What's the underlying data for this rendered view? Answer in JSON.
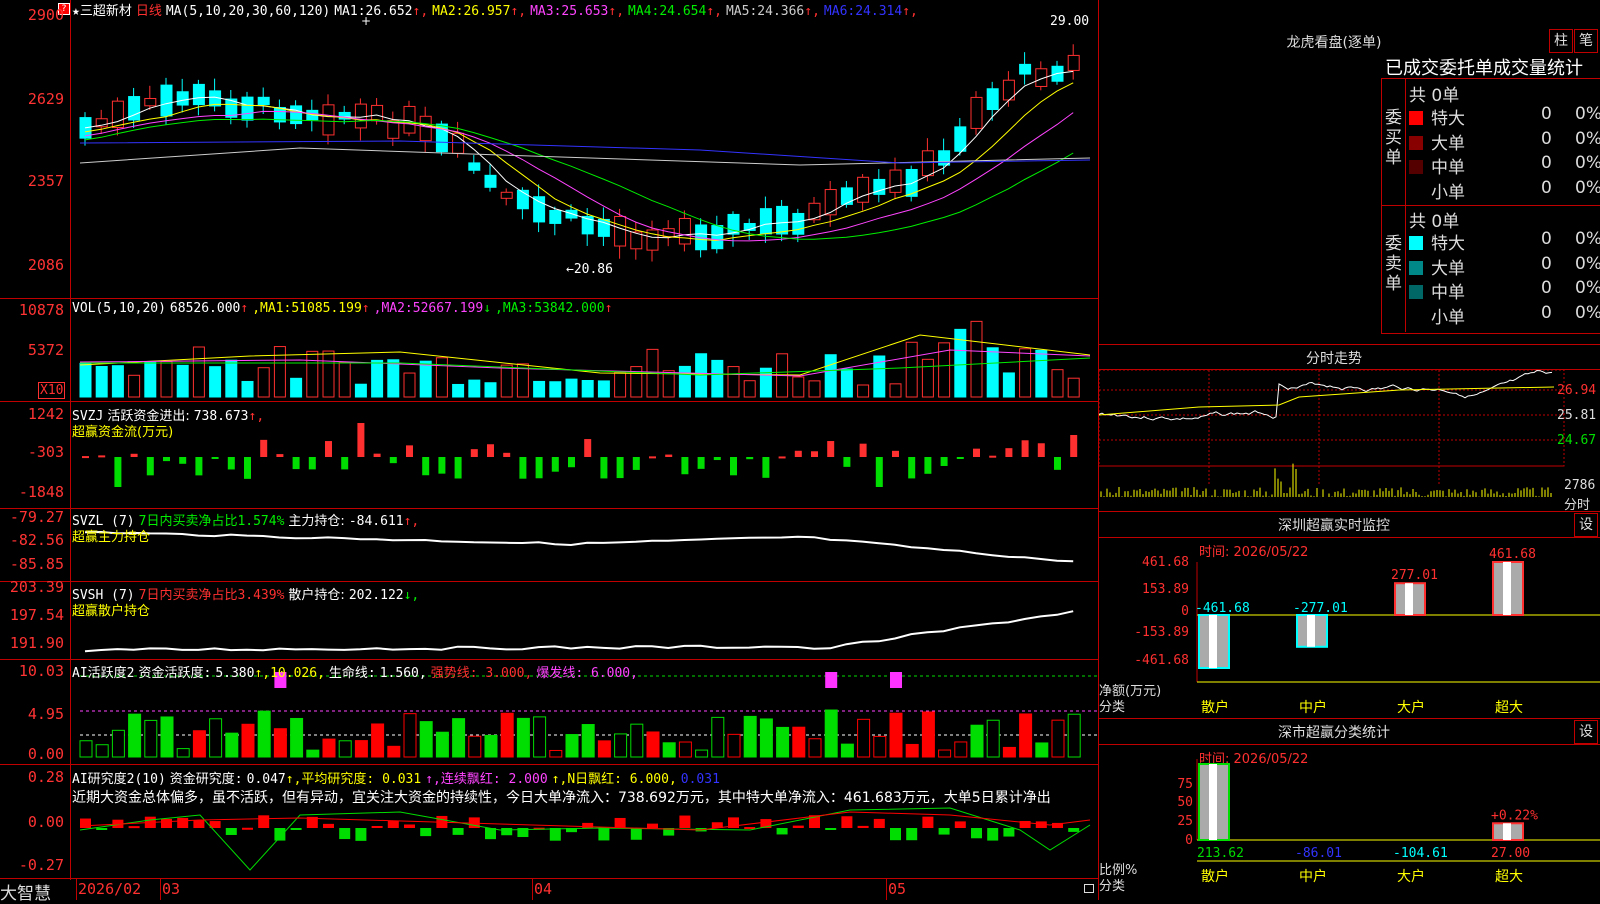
{
  "main": {
    "star": "★",
    "stock_name": "三超新材",
    "period": "日线",
    "ma_label": "MA(5,10,20,30,60,120)",
    "ma": [
      {
        "label": "MA1:",
        "value": "26.652",
        "arrow": "↑",
        "color": "#ffffff"
      },
      {
        "label": "MA2:",
        "value": "26.957",
        "arrow": "↑",
        "color": "#ffff00"
      },
      {
        "label": "MA3:",
        "value": "25.653",
        "arrow": "↑",
        "color": "#ff44ff"
      },
      {
        "label": "MA4:",
        "value": "24.654",
        "arrow": "↑",
        "color": "#00ee00"
      },
      {
        "label": "MA5:",
        "value": "24.366",
        "arrow": "↑",
        "color": "#cccccc"
      },
      {
        "label": "MA6:",
        "value": "24.314",
        "arrow": "↑",
        "color": "#3333ff"
      }
    ],
    "y_labels": [
      "2900",
      "2629",
      "2357",
      "2086"
    ],
    "high_label": "29.00",
    "low_label": "←20.86"
  },
  "vol": {
    "label": "VOL(5,10,20)",
    "value": "68526.000",
    "arrow": "↑",
    "ma": [
      {
        "label": "MA1:",
        "value": "51085.199",
        "arrow": "↑",
        "color": "#ffff00"
      },
      {
        "label": "MA2:",
        "value": "52667.199",
        "arrow": "↓",
        "color": "#ff44ff"
      },
      {
        "label": "MA3:",
        "value": "53842.000",
        "arrow": "↑",
        "color": "#00ee00"
      }
    ],
    "y_labels": [
      "10878",
      "5372"
    ],
    "unit": "X10"
  },
  "svzj": {
    "title": "SVZJ",
    "desc": "活跃资金进出:",
    "value": "738.673",
    "arrow": "↑,",
    "sub": "超赢资金流(万元)",
    "y_labels": [
      "1242",
      "-303",
      "-1848"
    ]
  },
  "svzl": {
    "title": "SVZL (7)",
    "ratio": "7日内买卖净占比1.574%",
    "label": "主力持仓:",
    "value": "-84.611",
    "arrow": "↑,",
    "sub": "超赢主力持仓",
    "y_labels": [
      "-79.27",
      "-82.56",
      "-85.85"
    ]
  },
  "svsh": {
    "title": "SVSH (7)",
    "ratio": "7日内买卖净占比3.439%",
    "label": "散户持仓:",
    "value": "202.122",
    "arrow": "↓,",
    "sub": "超赢散户持仓",
    "y_labels": [
      "203.39",
      "197.54",
      "191.90"
    ]
  },
  "ai1": {
    "title": "AI活跃度2",
    "label": "资金活跃度:",
    "value": "5.380",
    "v2": "↑,10.026,",
    "life_label": "生命线:",
    "life": "1.560,",
    "strong": "强势线: 3.000,",
    "burst": "爆发线: 6.000,",
    "y_labels": [
      "10.03",
      "4.95",
      "0.00"
    ]
  },
  "ai2": {
    "title": "AI研究度2(10)",
    "label": "资金研究度:",
    "value": "0.047",
    "avg": "↑,平均研究度: 0.031",
    "red": "↑,连续飘红: 2.000",
    "nred": "↑,N日飘红: 6.000,",
    "last": "0.031",
    "comment": "近期大资金总体偏多，虽不活跃，但有异动，宜关注大资金的持续性，今日大单净流入：738.692万元，其中特大单净流入：461.683万元，大单5日累计净出",
    "y_labels": [
      "0.28",
      "0.00",
      "-0.27"
    ]
  },
  "footer": {
    "brand": "大智慧",
    "dates": [
      "2026/02",
      "03",
      "04",
      "05"
    ]
  },
  "dragon": {
    "title": "龙虎看盘(逐单)",
    "btn1": "柱",
    "btn2": "笔",
    "tabs": "已成交委托单成交量统计",
    "buy_label": "委买单",
    "sell_label": "委卖单",
    "buy_total": "共 0单",
    "sell_total": "共 0单",
    "buy_rows": [
      {
        "name": "特大",
        "count": "0",
        "pct": "0%",
        "color": "#ff0000"
      },
      {
        "name": "大单",
        "count": "0",
        "pct": "0%",
        "color": "#880000"
      },
      {
        "name": "中单",
        "count": "0",
        "pct": "0%",
        "color": "#550000"
      },
      {
        "name": "小单",
        "count": "0",
        "pct": "0%",
        "color": ""
      }
    ],
    "sell_rows": [
      {
        "name": "特大",
        "count": "0",
        "pct": "0%",
        "color": "#00ffff"
      },
      {
        "name": "大单",
        "count": "0",
        "pct": "0%",
        "color": "#008888"
      },
      {
        "name": "中单",
        "count": "0",
        "pct": "0%",
        "color": "#006666"
      },
      {
        "name": "小单",
        "count": "0",
        "pct": "0%",
        "color": ""
      }
    ]
  },
  "intraday": {
    "title": "分时走势",
    "y_labels": [
      "26.94",
      "25.81",
      "24.67"
    ],
    "vol_label": "2786",
    "vol_unit": "分时"
  },
  "sz_monitor": {
    "title": "深圳超赢实时监控",
    "btn": "设",
    "date": "时间: 2026/05/22",
    "y_labels": [
      "461.68",
      "153.89",
      "0",
      "-153.89",
      "-461.68"
    ],
    "unit": "净额(万元)",
    "cat_label": "分类",
    "bars": [
      {
        "cat": "散户",
        "value": -461.68,
        "label": "-461.68"
      },
      {
        "cat": "中户",
        "value": -277.01,
        "label": "-277.01"
      },
      {
        "cat": "大户",
        "value": 277.01,
        "label": "277.01"
      },
      {
        "cat": "超大",
        "value": 461.68,
        "label": "461.68"
      }
    ]
  },
  "sz_stat": {
    "title": "深市超赢分类统计",
    "btn": "设",
    "date": "时间: 2026/05/22",
    "y_labels": [
      "75",
      "50",
      "25",
      "0"
    ],
    "unit": "比例%",
    "cat_label": "分类",
    "bars": [
      {
        "cat": "散户",
        "value": 100,
        "label": "213.62"
      },
      {
        "cat": "中户",
        "value": 0,
        "label": "-86.01"
      },
      {
        "cat": "大户",
        "value": 0,
        "label": "-104.61"
      },
      {
        "cat": "超大",
        "value": 22,
        "label": "27.00",
        "top": "+0.22%"
      }
    ]
  },
  "colors": {
    "up": "#ff3030",
    "down": "#00ffff",
    "grid": "#c00000",
    "green": "#00dd00"
  }
}
